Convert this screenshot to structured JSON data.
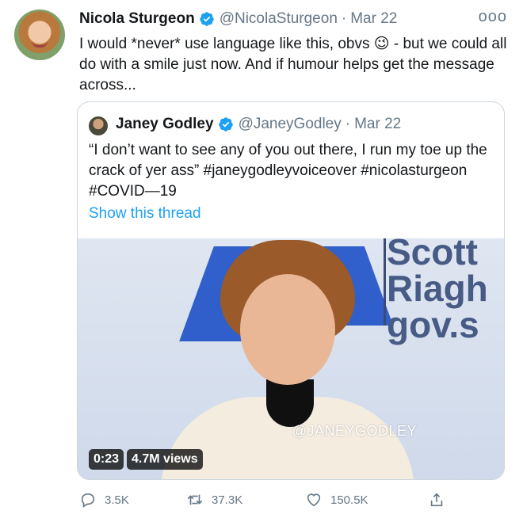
{
  "tweet": {
    "author_name": "Nicola Sturgeon",
    "author_handle": "@NicolaSturgeon",
    "separator": "·",
    "date": "Mar 22",
    "more_label": "ooo",
    "text": "I would *never* use language like this, obvs 😉 - but we could all do with a smile just now. And if humour helps get the message across..."
  },
  "quote": {
    "author_name": "Janey Godley",
    "author_handle": "@JaneyGodley",
    "separator": "·",
    "date": "Mar 22",
    "text": "“I don’t want to see any of you out there, I run my toe up the crack of yer ass” #janeygodleyvoiceover #nicolasturgeon #COVID—19",
    "show_thread": "Show this thread",
    "video": {
      "background_text": "Scott Riagh gov.s",
      "watermark": "@JANEYGODLEY",
      "duration": "0:23",
      "views": "4.7M views"
    }
  },
  "actions": {
    "replies": "3.5K",
    "retweets": "37.3K",
    "likes": "150.5K"
  },
  "colors": {
    "accent": "#1da1f2",
    "secondary_text": "#657786",
    "border": "#ccd6dd"
  }
}
